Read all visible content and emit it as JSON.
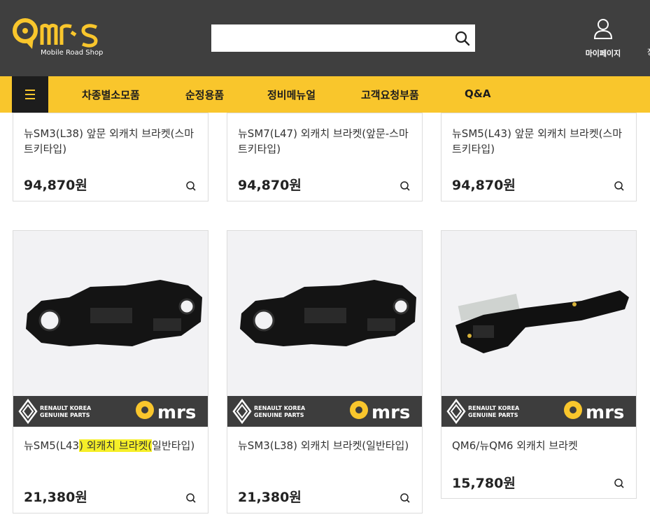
{
  "header": {
    "logo_sub": "Mobile Road Shop",
    "search_placeholder": "",
    "mypage_label": "마이페이지",
    "cut_label": "장"
  },
  "nav": {
    "items": [
      "차종별소모품",
      "순정용품",
      "정비메뉴얼",
      "고객요청부품",
      "Q&A"
    ]
  },
  "products_top": [
    {
      "title": "뉴SM3(L38) 앞문 외캐치 브라켓(스마트키타입)",
      "price": "94,870원"
    },
    {
      "title": "뉴SM7(L47) 외캐치 브라켓(앞문-스마트키타입)",
      "price": "94,870원"
    },
    {
      "title": "뉴SM5(L43) 앞문 외캐치 브라켓(스마트키타입)",
      "price": "94,870원"
    }
  ],
  "products_bottom": [
    {
      "title_pre": "뉴SM5(L43",
      "title_hl": ") 외캐치 브라켓(",
      "title_post": "일반타입)",
      "price": "21,380원",
      "badge": "RENAULT KOREA\nGENUINE PARTS"
    },
    {
      "title_pre": "뉴SM3(L38) 외캐치 브라켓(일반타입)",
      "title_hl": "",
      "title_post": "",
      "price": "21,380원",
      "badge": "RENAULT KOREA\nGENUINE PARTS"
    },
    {
      "title_pre": "QM6/뉴QM6 외캐치 브라켓",
      "title_hl": "",
      "title_post": "",
      "price": "15,780원",
      "badge": "RENAULT KOREA\nGENUINE PARTS"
    }
  ],
  "brand": {
    "badge_line1": "RENAULT KOREA",
    "badge_line2": "GENUINE PARTS"
  },
  "colors": {
    "header_bg": "#3f3f3f",
    "nav_bg": "#f9c62c",
    "accent": "#f9c62c",
    "highlight": "#f6ef28"
  }
}
